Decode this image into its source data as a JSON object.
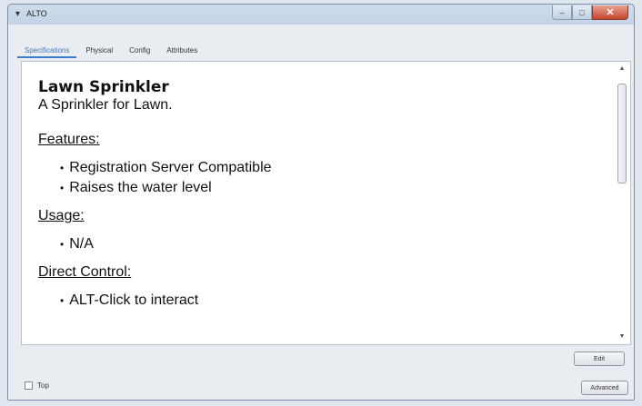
{
  "window": {
    "title": "ALTO"
  },
  "tabs": [
    {
      "label": "Specifications",
      "active": true
    },
    {
      "label": "Physical",
      "active": false
    },
    {
      "label": "Config",
      "active": false
    },
    {
      "label": "Attributes",
      "active": false
    }
  ],
  "content": {
    "heading": "Lawn Sprinkler",
    "subtitle": "A Sprinkler for Lawn.",
    "features_title": "Features:",
    "features": [
      "Registration Server Compatible",
      "Raises the water level"
    ],
    "usage_title": "Usage:",
    "usage": [
      "N/A"
    ],
    "direct_control_title": "Direct Control:",
    "direct_control": [
      "ALT-Click to interact"
    ]
  },
  "buttons": {
    "edit": "Edit",
    "advanced": "Advanced"
  },
  "footer": {
    "top_checkbox_label": "Top"
  },
  "colors": {
    "active_tab": "#3d7cc9",
    "close_button": "#c4442b"
  }
}
